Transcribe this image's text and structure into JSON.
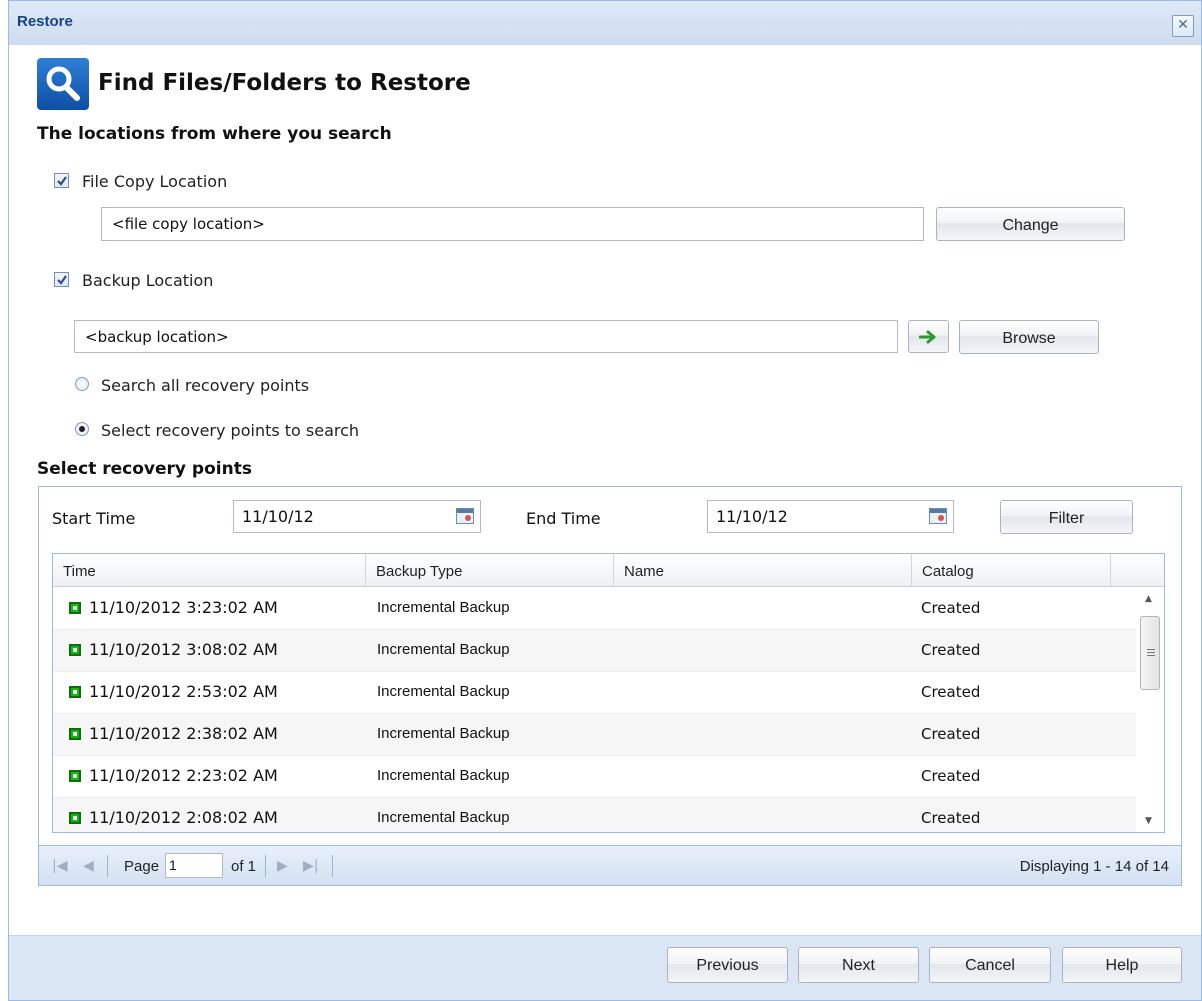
{
  "window": {
    "title": "Restore",
    "close_glyph": "✕"
  },
  "heading": {
    "title": "Find Files/Folders to Restore",
    "icon": "search-icon"
  },
  "locations": {
    "section_title": "The locations from where you search",
    "file_copy": {
      "label": "File Copy Location",
      "checked": true,
      "value": "<file copy location>",
      "button": "Change"
    },
    "backup": {
      "label": "Backup Location",
      "checked": true,
      "value": "<backup location>",
      "button": "Browse",
      "go_icon": "arrow-right-icon"
    },
    "search_all_label": "Search all recovery points",
    "select_points_label": "Select recovery points to search",
    "selected_option": "select_points"
  },
  "recovery": {
    "section_title": "Select recovery points",
    "start_label": "Start Time",
    "start_value": "11/10/12",
    "end_label": "End Time",
    "end_value": "11/10/12",
    "filter_button": "Filter",
    "columns": [
      "Time",
      "Backup Type",
      "Name",
      "Catalog"
    ],
    "rows": [
      {
        "time": "11/10/2012 3:23:02 AM",
        "type": "Incremental Backup",
        "name": "",
        "catalog": "Created"
      },
      {
        "time": "11/10/2012 3:08:02 AM",
        "type": "Incremental Backup",
        "name": "",
        "catalog": "Created"
      },
      {
        "time": "11/10/2012 2:53:02 AM",
        "type": "Incremental Backup",
        "name": "",
        "catalog": "Created"
      },
      {
        "time": "11/10/2012 2:38:02 AM",
        "type": "Incremental Backup",
        "name": "",
        "catalog": "Created"
      },
      {
        "time": "11/10/2012 2:23:02 AM",
        "type": "Incremental Backup",
        "name": "",
        "catalog": "Created"
      },
      {
        "time": "11/10/2012 2:08:02 AM",
        "type": "Incremental Backup",
        "name": "",
        "catalog": "Created"
      }
    ],
    "pager": {
      "page_label": "Page",
      "page_value": "1",
      "of_label": "of 1",
      "display_text": "Displaying 1 - 14 of 14"
    }
  },
  "footer": {
    "previous": "Previous",
    "next": "Next",
    "cancel": "Cancel",
    "help": "Help"
  }
}
